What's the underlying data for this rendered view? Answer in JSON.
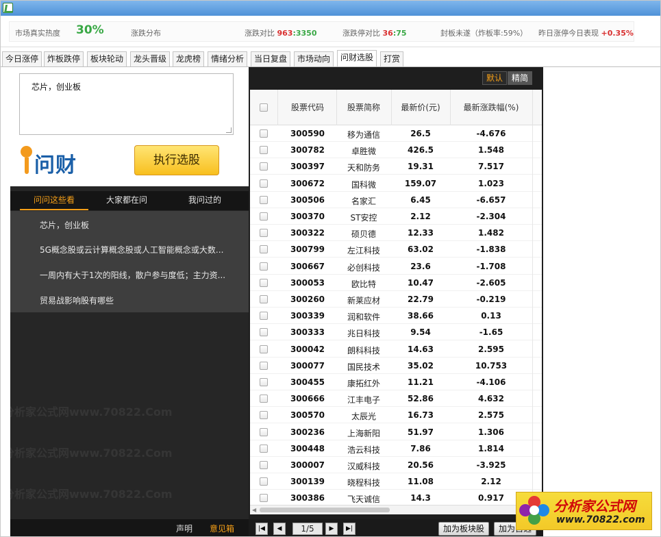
{
  "stats": {
    "heat_label": "市场真实热度",
    "heat_value": "30%",
    "distribution_label": "涨跌分布",
    "updown_label": "涨跌对比",
    "up_count": "963",
    "sep1": ":",
    "down_count": "3350",
    "limit_label": "涨跌停对比",
    "limit_up": "36",
    "sep2": ":",
    "limit_down": "75",
    "seal_label": "封板未遂（炸板率:59%）",
    "yesterday_label": "昨日涨停今日表现",
    "yesterday_value": "+0.35%"
  },
  "tabs": [
    "今日涨停",
    "炸板跌停",
    "板块轮动",
    "龙头晋级",
    "龙虎榜",
    "情绪分析",
    "当日复盘",
    "市场动向",
    "问财选股",
    "打赏"
  ],
  "query": {
    "text": "芯片，创业板",
    "logo_text": "问财",
    "run_button": "执行选股"
  },
  "left_tabs": [
    "问问这些看",
    "大家都在问",
    "我问过的"
  ],
  "left_items": [
    "芯片，创业板",
    "5G概念股或云计算概念股或人工智能概念或大数...",
    "一周内有大于1次的阳线，散户参与度低；主力资...",
    "贸易战影响股有哪些"
  ],
  "left_footer": {
    "statement": "声明",
    "feedback": "意见箱"
  },
  "watermark": {
    "text": "分析家公式网www.70822.Com"
  },
  "sort": {
    "default": "默认",
    "refine": "精简"
  },
  "table": {
    "headers": [
      "股票代码",
      "股票简称",
      "最新价(元)",
      "最新涨跌幅(%)"
    ],
    "rows": [
      {
        "code": "300590",
        "name": "移为通信",
        "price": "26.5",
        "change": "-4.676"
      },
      {
        "code": "300782",
        "name": "卓胜微",
        "price": "426.5",
        "change": "1.548"
      },
      {
        "code": "300397",
        "name": "天和防务",
        "price": "19.31",
        "change": "7.517"
      },
      {
        "code": "300672",
        "name": "国科微",
        "price": "159.07",
        "change": "1.023"
      },
      {
        "code": "300506",
        "name": "名家汇",
        "price": "6.45",
        "change": "-6.657"
      },
      {
        "code": "300370",
        "name": "ST安控",
        "price": "2.12",
        "change": "-2.304"
      },
      {
        "code": "300322",
        "name": "硕贝德",
        "price": "12.33",
        "change": "1.482"
      },
      {
        "code": "300799",
        "name": "左江科技",
        "price": "63.02",
        "change": "-1.838"
      },
      {
        "code": "300667",
        "name": "必创科技",
        "price": "23.6",
        "change": "-1.708"
      },
      {
        "code": "300053",
        "name": "欧比特",
        "price": "10.47",
        "change": "-2.605"
      },
      {
        "code": "300260",
        "name": "新莱应材",
        "price": "22.79",
        "change": "-0.219"
      },
      {
        "code": "300339",
        "name": "润和软件",
        "price": "38.66",
        "change": "0.13"
      },
      {
        "code": "300333",
        "name": "兆日科技",
        "price": "9.54",
        "change": "-1.65"
      },
      {
        "code": "300042",
        "name": "朗科科技",
        "price": "14.63",
        "change": "2.595"
      },
      {
        "code": "300077",
        "name": "国民技术",
        "price": "35.02",
        "change": "10.753"
      },
      {
        "code": "300455",
        "name": "康拓红外",
        "price": "11.21",
        "change": "-4.106"
      },
      {
        "code": "300666",
        "name": "江丰电子",
        "price": "52.86",
        "change": "4.632"
      },
      {
        "code": "300570",
        "name": "太辰光",
        "price": "16.73",
        "change": "2.575"
      },
      {
        "code": "300236",
        "name": "上海新阳",
        "price": "51.97",
        "change": "1.306"
      },
      {
        "code": "300448",
        "name": "浩云科技",
        "price": "7.86",
        "change": "1.814"
      },
      {
        "code": "300007",
        "name": "汉威科技",
        "price": "20.56",
        "change": "-3.925"
      },
      {
        "code": "300139",
        "name": "晓程科技",
        "price": "11.08",
        "change": "2.12"
      },
      {
        "code": "300386",
        "name": "飞天诚信",
        "price": "14.3",
        "change": "0.917"
      }
    ]
  },
  "pager": {
    "page": "1/5",
    "add_sector": "加为板块股",
    "add_other": "加为自选"
  },
  "brand": {
    "name": "分析家公式网",
    "url": "www.70822.com"
  },
  "colors": {
    "up": "#d93030",
    "accent": "#f6a018",
    "heat": "#39a845"
  }
}
